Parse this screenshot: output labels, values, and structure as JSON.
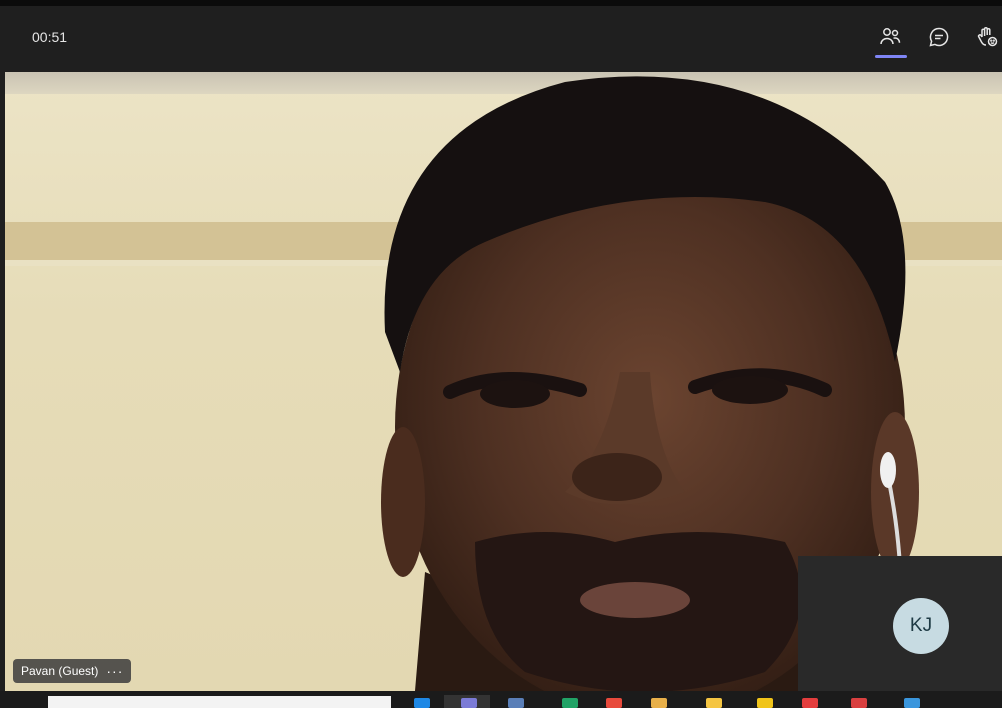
{
  "meeting": {
    "timer": "00:51",
    "participant_name": "Pavan (Guest)",
    "more_label": "···",
    "self_initials": "KJ"
  },
  "toolbar": {
    "icons": [
      "people-icon",
      "chat-icon",
      "raise-hand-icon"
    ],
    "accent_color": "#7f85f5"
  },
  "taskbar": {
    "app_colors": [
      "#1e88e5",
      "#7b7bd6",
      "#5a7fb8",
      "#21a366",
      "#e84a3c",
      "#e8b04a",
      "#f5c542",
      "#f0c419",
      "#e33d3d",
      "#d94040",
      "#3a96dd"
    ]
  }
}
